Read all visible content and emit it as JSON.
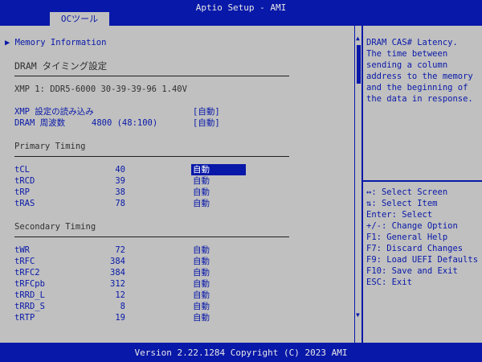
{
  "app": {
    "title": "Aptio Setup - AMI"
  },
  "tabs": [
    {
      "label": "OCツール"
    }
  ],
  "main": {
    "memory_info": "▶ Memory Information",
    "dram_timing_title": "DRAM タイミング設定",
    "xmp_profile": "XMP 1: DDR5-6000 30-39-39-96 1.40V",
    "xmp_load": {
      "label": "XMP 設定の読み込み",
      "value": "[自動]"
    },
    "dram_freq": {
      "label": "DRAM 周波数",
      "info": "4800 (48:100)",
      "value": "[自動]"
    },
    "primary_title": "Primary Timing",
    "primary": [
      {
        "name": "tCL",
        "current": "40",
        "setting": "自動"
      },
      {
        "name": "tRCD",
        "current": "39",
        "setting": "自動"
      },
      {
        "name": "tRP",
        "current": "38",
        "setting": "自動"
      },
      {
        "name": "tRAS",
        "current": "78",
        "setting": "自動"
      }
    ],
    "secondary_title": "Secondary Timing",
    "secondary": [
      {
        "name": "tWR",
        "current": "72",
        "setting": "自動"
      },
      {
        "name": "tRFC",
        "current": "384",
        "setting": "自動"
      },
      {
        "name": "tRFC2",
        "current": "384",
        "setting": "自動"
      },
      {
        "name": "tRFCpb",
        "current": "312",
        "setting": "自動"
      },
      {
        "name": "tRRD_L",
        "current": "12",
        "setting": "自動"
      },
      {
        "name": "tRRD_S",
        "current": "8",
        "setting": "自動"
      },
      {
        "name": "tRTP",
        "current": "19",
        "setting": "自動"
      }
    ]
  },
  "scrollbar": {
    "up": "▲",
    "down": "▼"
  },
  "help": {
    "description": [
      "DRAM CAS# Latency.",
      "The time between",
      "sending a column",
      "address to the memory",
      "and the beginning of",
      "the data in response."
    ],
    "keys": [
      "↔: Select Screen",
      "⇅: Select Item",
      "Enter: Select",
      "+/-: Change Option",
      "F1: General Help",
      "F7: Discard Changes",
      "F9: Load UEFI Defaults",
      "F10: Save and Exit",
      "ESC: Exit"
    ]
  },
  "status": {
    "text": "Version 2.22.1284 Copyright (C) 2023 AMI"
  }
}
